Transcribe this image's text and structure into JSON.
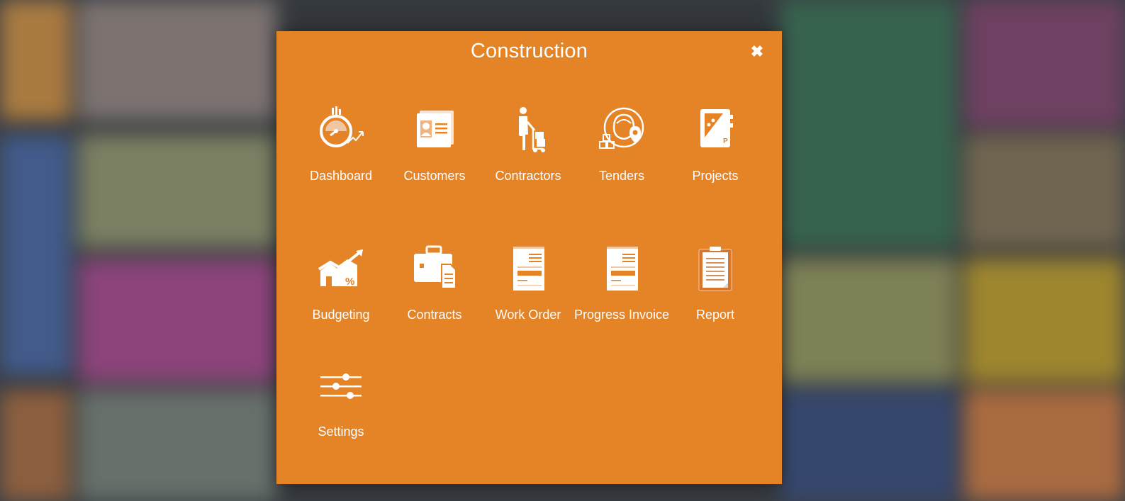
{
  "modal": {
    "title": "Construction",
    "close_icon": "close-icon",
    "apps": [
      {
        "label": "Dashboard",
        "icon": "dashboard-icon"
      },
      {
        "label": "Customers",
        "icon": "customers-icon"
      },
      {
        "label": "Contractors",
        "icon": "contractors-icon"
      },
      {
        "label": "Tenders",
        "icon": "tenders-icon"
      },
      {
        "label": "Projects",
        "icon": "projects-icon"
      },
      {
        "label": "Budgeting",
        "icon": "budgeting-icon"
      },
      {
        "label": "Contracts",
        "icon": "contracts-icon"
      },
      {
        "label": "Work Order",
        "icon": "work-order-icon"
      },
      {
        "label": "Progress Invoice",
        "icon": "progress-invoice-icon"
      },
      {
        "label": "Report",
        "icon": "report-icon"
      },
      {
        "label": "Settings",
        "icon": "settings-icon"
      }
    ]
  },
  "colors": {
    "modal_background": "#e58426",
    "text": "#ffffff"
  }
}
